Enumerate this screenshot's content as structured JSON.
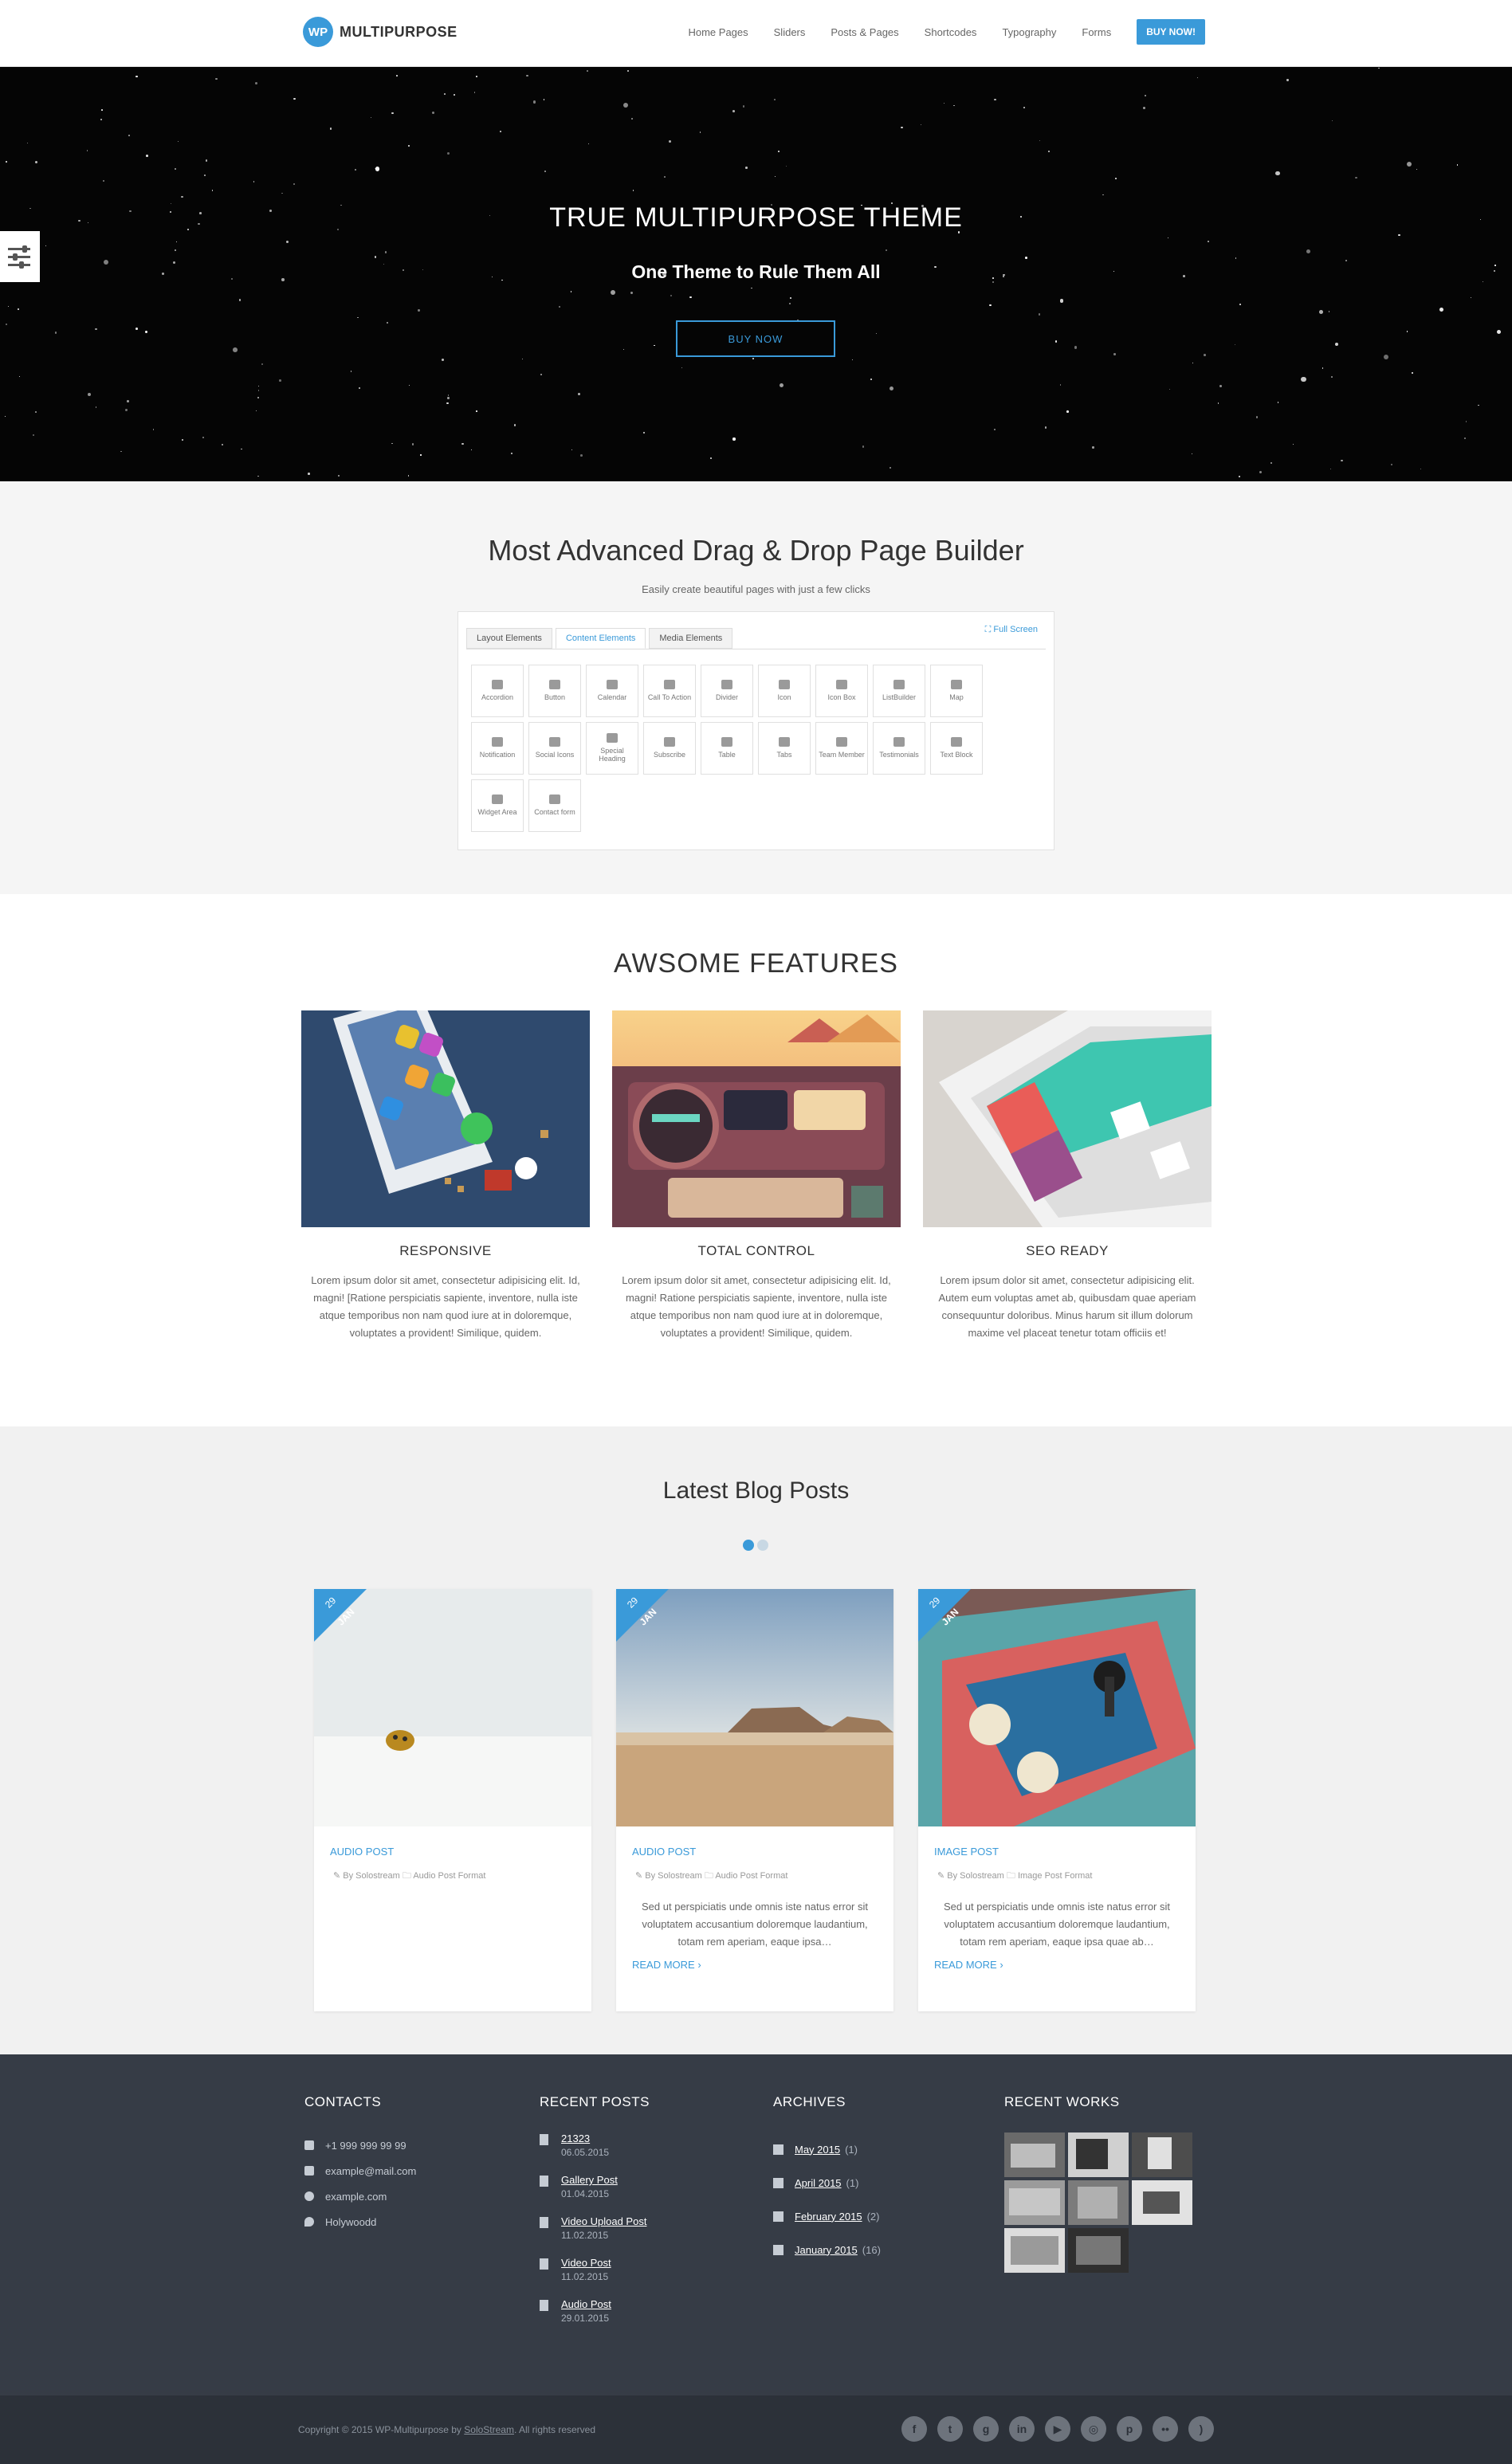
{
  "header": {
    "logo_badge": "WP",
    "logo_text": "MULTIPURPOSE",
    "nav": [
      "Home Pages",
      "Sliders",
      "Posts & Pages",
      "Shortcodes",
      "Typography",
      "Forms"
    ],
    "buy_label": "BUY NOW!"
  },
  "hero": {
    "title": "TRUE MULTIPURPOSE THEME",
    "subtitle": "One Theme to Rule Them All",
    "button": "BUY NOW"
  },
  "builder": {
    "title": "Most Advanced Drag & Drop Page Builder",
    "subtitle": "Easily create beautiful pages with just a few clicks",
    "tabs": [
      "Layout Elements",
      "Content Elements",
      "Media Elements"
    ],
    "full_screen": "Full Screen",
    "elements": [
      "Accordion",
      "Button",
      "Calendar",
      "Call To Action",
      "Divider",
      "Icon",
      "Icon Box",
      "ListBuilder",
      "Map",
      "Notification",
      "Social Icons",
      "Special Heading",
      "Subscribe",
      "Table",
      "Tabs",
      "Team Member",
      "Testimonials",
      "Text Block",
      "Widget Area",
      "Contact form"
    ]
  },
  "features": {
    "title": "AWSOME FEATURES",
    "items": [
      {
        "name": "RESPONSIVE",
        "text": "Lorem ipsum dolor sit amet, consectetur adipisicing elit. Id, magni! [Ratione perspiciatis sapiente, inventore, nulla iste atque temporibus non nam quod iure at in doloremque, voluptates a provident! Similique, quidem."
      },
      {
        "name": "TOTAL CONTROL",
        "text": "Lorem ipsum dolor sit amet, consectetur adipisicing elit. Id, magni! Ratione perspiciatis sapiente, inventore, nulla iste atque temporibus non nam quod iure at in doloremque, voluptates a provident! Similique, quidem."
      },
      {
        "name": "SEO READY",
        "text": "Lorem ipsum dolor sit amet, consectetur adipisicing elit. Autem eum voluptas amet ab, quibusdam quae aperiam consequuntur doloribus. Minus harum sit illum dolorum maxime vel placeat tenetur totam officiis et!"
      }
    ]
  },
  "blog": {
    "title": "Latest Blog Posts",
    "posts": [
      {
        "day": "29",
        "month": "JAN",
        "category": "AUDIO POST",
        "author": "By Solostream",
        "format": "Audio Post Format",
        "excerpt": "",
        "more": ""
      },
      {
        "day": "29",
        "month": "JAN",
        "category": "AUDIO POST",
        "author": "By Solostream",
        "format": "Audio Post Format",
        "excerpt": "Sed ut perspiciatis unde omnis iste natus error sit voluptatem accusantium doloremque laudantium, totam rem aperiam, eaque ipsa…",
        "more": "READ MORE ›"
      },
      {
        "day": "29",
        "month": "JAN",
        "category": "IMAGE POST",
        "author": "By Solostream",
        "format": "Image Post Format",
        "excerpt": "Sed ut perspiciatis unde omnis iste natus error sit voluptatem accusantium doloremque laudantium, totam rem aperiam, eaque ipsa quae ab…",
        "more": "READ MORE ›"
      }
    ]
  },
  "footer": {
    "contacts": {
      "title": "CONTACTS",
      "items": [
        {
          "icon": "phone-icon",
          "text": "+1 999 999 99 99"
        },
        {
          "icon": "mail-icon",
          "text": "example@mail.com"
        },
        {
          "icon": "globe-icon",
          "text": "example.com"
        },
        {
          "icon": "location-icon",
          "text": "Holywoodd"
        }
      ]
    },
    "recent_posts": {
      "title": "RECENT POSTS",
      "items": [
        {
          "title": "21323",
          "date": "06.05.2015"
        },
        {
          "title": "Gallery Post",
          "date": "01.04.2015"
        },
        {
          "title": "Video Upload Post",
          "date": "11.02.2015"
        },
        {
          "title": "Video Post",
          "date": "11.02.2015"
        },
        {
          "title": "Audio Post",
          "date": "29.01.2015"
        }
      ]
    },
    "archives": {
      "title": "ARCHIVES",
      "items": [
        {
          "label": "May 2015",
          "count": "(1)"
        },
        {
          "label": "April 2015",
          "count": "(1)"
        },
        {
          "label": "February 2015",
          "count": "(2)"
        },
        {
          "label": "January 2015",
          "count": "(16)"
        }
      ]
    },
    "recent_works": {
      "title": "RECENT WORKS"
    }
  },
  "bottom": {
    "copyright_pre": "Copyright © 2015 WP-Multipurpose by",
    "copyright_link": "SoloStream",
    "copyright_post": ". All rights reserved",
    "socials": [
      "facebook-icon",
      "twitter-icon",
      "google-plus-icon",
      "linkedin-icon",
      "youtube-icon",
      "instagram-icon",
      "pinterest-icon",
      "flickr-icon",
      "rss-icon"
    ]
  },
  "colors": {
    "accent": "#3a9ad9",
    "footer_bg": "#363c46",
    "bottom_bg": "#2c3139"
  }
}
